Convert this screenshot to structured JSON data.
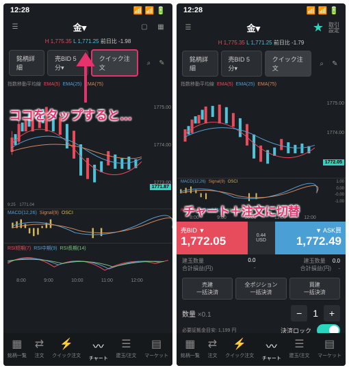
{
  "status": {
    "time": "12:28"
  },
  "header": {
    "title": "金",
    "hi": "1,775.35",
    "lo": "1,771.25",
    "chg_l": "前日比 -1.98",
    "chg_r": "前日比 -1.79",
    "settings": "取引\n設定"
  },
  "tabs": {
    "detail": "銘柄詳細",
    "bid": "売BID 5分",
    "quick": "クイック注文"
  },
  "indicators": {
    "ma": "指数移動平均線",
    "ema5": "EMA(5)",
    "ema25": "EMA(25)",
    "ema75": "EMA(75)",
    "macd": "MACD(12,26)",
    "signal": "Signal(9)",
    "osci": "OSCI",
    "rsi": "RSI短期(7)",
    "rsim": "RSI中期(9)",
    "rsil": "RSI長期(14)"
  },
  "prices": {
    "tag_l": "1771.87",
    "tag_r": "1772.05",
    "y": [
      "1775.00",
      "1774.00",
      "1773.00"
    ],
    "y2": [
      "1775.00",
      "1774.00",
      "1773.00"
    ],
    "osc_y": [
      "1.00",
      "0.00",
      "-0.00",
      "-1.00"
    ],
    "t1": "9:25",
    "p1": "1771.04"
  },
  "xaxis": [
    "8:00",
    "9:00",
    "10:00",
    "11:00",
    "12:00"
  ],
  "xaxis2": [
    "8:00",
    "9:00",
    "10:00",
    "11:00",
    "12:00"
  ],
  "order": {
    "bid_lbl": "売BID",
    "ask_lbl": "ASK買",
    "bid": "1,772.05",
    "ask": "1,772.49",
    "spread": "0.44",
    "unit": "USD",
    "pos_qty": "建玉数量",
    "pos_pl": "合計損益(円)",
    "zero": "0.0",
    "dash": "-",
    "close_sell": "売建\n一括決済",
    "all_pos": "全ポジション\n一括決済",
    "close_buy": "買建\n一括決済",
    "qty_lbl": "数量",
    "qty_mult": "×0.1",
    "req": "必要証拠金目安: 1,199 円",
    "lock": "決済ロック"
  },
  "annot": {
    "left": "ココをタップすると…",
    "right": "チャート＋注文に切替"
  },
  "nav": {
    "list": "銘柄一覧",
    "order": "注文",
    "quick": "クイック注文",
    "chart": "チャート",
    "pos": "建玉/注文",
    "market": "マーケット"
  }
}
